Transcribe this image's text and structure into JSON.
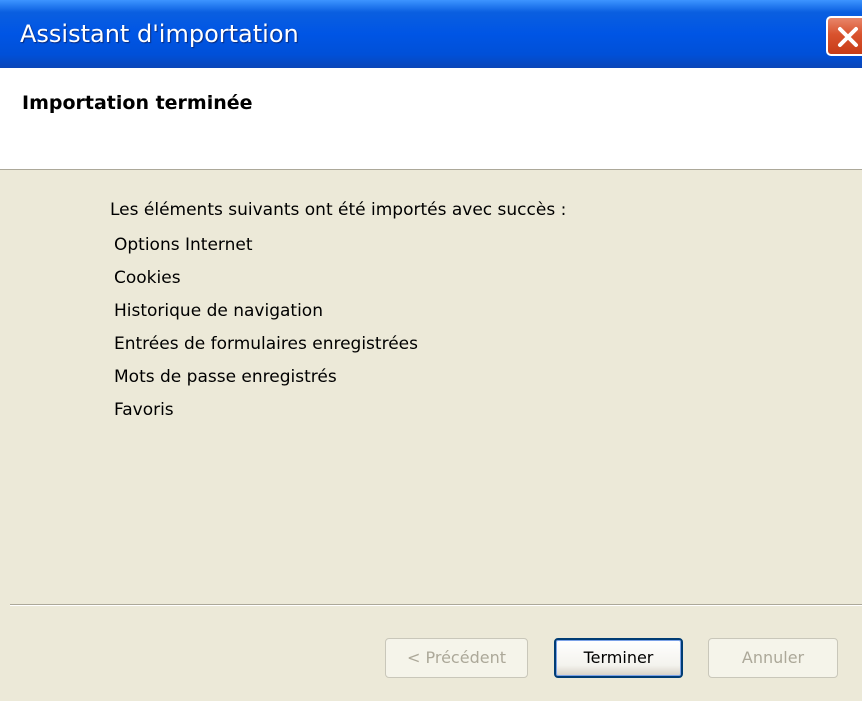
{
  "window": {
    "title": "Assistant d'importation"
  },
  "header": {
    "title": "Importation terminée"
  },
  "content": {
    "intro": "Les éléments suivants ont été importés avec succès :",
    "items": [
      "Options Internet",
      "Cookies",
      "Historique de navigation",
      "Entrées de formulaires enregistrées",
      "Mots de passe enregistrés",
      "Favoris"
    ]
  },
  "buttons": {
    "previous": "< Précédent",
    "finish": "Terminer",
    "cancel": "Annuler"
  },
  "colors": {
    "titlebar": "#0055e5",
    "close_button": "#d9532e",
    "dialog_background": "#ece9d8",
    "header_background": "#ffffff"
  },
  "icons": {
    "close": "close-icon"
  }
}
